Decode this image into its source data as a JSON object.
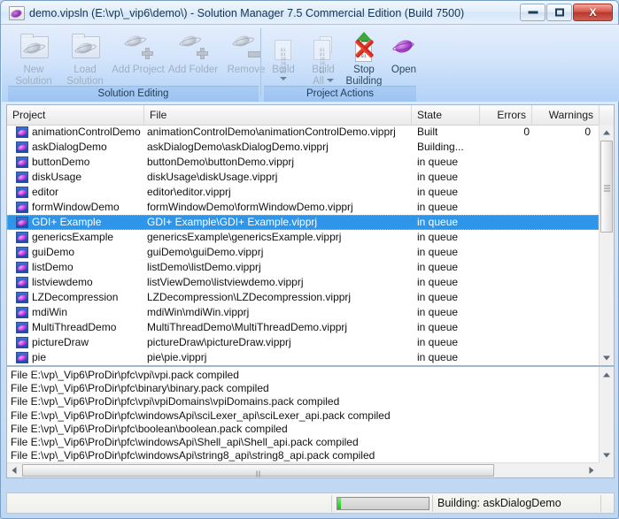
{
  "window": {
    "title": "demo.vipsln (E:\\vp\\_vip6\\demo\\)  - Solution Manager 7.5 Commercial Edition (Build 7500)",
    "minimize_label": "Minimize",
    "maximize_label": "Maximize",
    "close_label": "X"
  },
  "ribbon": {
    "groups": [
      {
        "label": "Solution Editing",
        "items": [
          {
            "label": "New\nSolution",
            "icon": "new-solution-icon",
            "disabled": true
          },
          {
            "label": "Load\nSolution",
            "icon": "load-solution-icon",
            "disabled": true
          },
          {
            "label": "Add Project",
            "icon": "add-project-icon",
            "disabled": true
          },
          {
            "label": "Add Folder",
            "icon": "add-folder-icon",
            "disabled": true
          },
          {
            "label": "Remove",
            "icon": "remove-icon",
            "disabled": true
          }
        ]
      },
      {
        "label": "Project Actions",
        "items": [
          {
            "label": "Build",
            "icon": "build-icon",
            "disabled": true,
            "dropdown": true
          },
          {
            "label": "Build\nAll",
            "icon": "build-all-icon",
            "disabled": true,
            "dropdown": true
          },
          {
            "label": "Stop\nBuilding",
            "icon": "stop-building-icon",
            "disabled": false
          },
          {
            "label": "Open",
            "icon": "open-icon",
            "disabled": false
          }
        ]
      }
    ]
  },
  "list": {
    "columns": [
      {
        "label": "Project",
        "align": "left"
      },
      {
        "label": "File",
        "align": "left"
      },
      {
        "label": "State",
        "align": "left"
      },
      {
        "label": "Errors",
        "align": "right"
      },
      {
        "label": "Warnings",
        "align": "right"
      }
    ],
    "rows": [
      {
        "project": "animationControlDemo",
        "file": "animationControlDemo\\animationControlDemo.vipprj",
        "state": "Built",
        "errors": "0",
        "warnings": "0",
        "selected": false
      },
      {
        "project": "askDialogDemo",
        "file": "askDialogDemo\\askDialogDemo.vipprj",
        "state": "Building...",
        "errors": "",
        "warnings": "",
        "selected": false
      },
      {
        "project": "buttonDemo",
        "file": "buttonDemo\\buttonDemo.vipprj",
        "state": "in queue",
        "errors": "",
        "warnings": "",
        "selected": false
      },
      {
        "project": "diskUsage",
        "file": "diskUsage\\diskUsage.vipprj",
        "state": "in queue",
        "errors": "",
        "warnings": "",
        "selected": false
      },
      {
        "project": "editor",
        "file": "editor\\editor.vipprj",
        "state": "in queue",
        "errors": "",
        "warnings": "",
        "selected": false
      },
      {
        "project": "formWindowDemo",
        "file": "formWindowDemo\\formWindowDemo.vipprj",
        "state": "in queue",
        "errors": "",
        "warnings": "",
        "selected": false
      },
      {
        "project": "GDI+ Example",
        "file": "GDI+ Example\\GDI+ Example.vipprj",
        "state": "in queue",
        "errors": "",
        "warnings": "",
        "selected": true
      },
      {
        "project": "genericsExample",
        "file": "genericsExample\\genericsExample.vipprj",
        "state": "in queue",
        "errors": "",
        "warnings": "",
        "selected": false
      },
      {
        "project": "guiDemo",
        "file": "guiDemo\\guiDemo.vipprj",
        "state": "in queue",
        "errors": "",
        "warnings": "",
        "selected": false
      },
      {
        "project": "listDemo",
        "file": "listDemo\\listDemo.vipprj",
        "state": "in queue",
        "errors": "",
        "warnings": "",
        "selected": false
      },
      {
        "project": "listviewdemo",
        "file": "listViewDemo\\listviewdemo.vipprj",
        "state": "in queue",
        "errors": "",
        "warnings": "",
        "selected": false
      },
      {
        "project": "LZDecompression",
        "file": "LZDecompression\\LZDecompression.vipprj",
        "state": "in queue",
        "errors": "",
        "warnings": "",
        "selected": false
      },
      {
        "project": "mdiWin",
        "file": "mdiWin\\mdiWin.vipprj",
        "state": "in queue",
        "errors": "",
        "warnings": "",
        "selected": false
      },
      {
        "project": "MultiThreadDemo",
        "file": "MultiThreadDemo\\MultiThreadDemo.vipprj",
        "state": "in queue",
        "errors": "",
        "warnings": "",
        "selected": false
      },
      {
        "project": "pictureDraw",
        "file": "pictureDraw\\pictureDraw.vipprj",
        "state": "in queue",
        "errors": "",
        "warnings": "",
        "selected": false
      },
      {
        "project": "pie",
        "file": "pie\\pie.vipprj",
        "state": "in queue",
        "errors": "",
        "warnings": "",
        "selected": false
      }
    ]
  },
  "log": {
    "lines": "File E:\\vp\\_Vip6\\ProDir\\pfc\\vpi\\vpi.pack compiled\nFile E:\\vp\\_Vip6\\ProDir\\pfc\\binary\\binary.pack compiled\nFile E:\\vp\\_Vip6\\ProDir\\pfc\\vpi\\vpiDomains\\vpiDomains.pack compiled\nFile E:\\vp\\_Vip6\\ProDir\\pfc\\windowsApi\\sciLexer_api\\sciLexer_api.pack compiled\nFile E:\\vp\\_Vip6\\ProDir\\pfc\\boolean\\boolean.pack compiled\nFile E:\\vp\\_Vip6\\ProDir\\pfc\\windowsApi\\Shell_api\\Shell_api.pack compiled\nFile E:\\vp\\_Vip6\\ProDir\\pfc\\windowsApi\\string8_api\\string8_api.pack compiled\nFile E:\\vp\\_Vip6\\ProDir\\pfc\\windowsApi\\string_api\\string_api.pack compiled"
  },
  "status": {
    "message": "Building: askDialogDemo",
    "progress_percent": 4
  },
  "colors": {
    "selection": "#2f95e8",
    "accent": "#a9ccf4",
    "progress_fill": "#19c219",
    "close_button": "#b8372c"
  }
}
